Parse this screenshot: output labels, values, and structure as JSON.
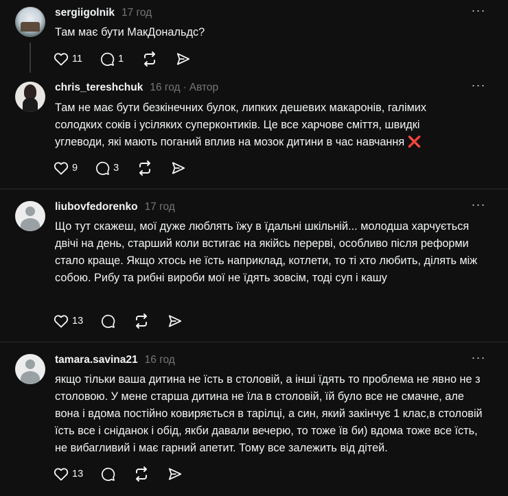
{
  "posts": [
    {
      "username": "sergiigolnik",
      "time": "17 год",
      "text": "Там має бути МакДональдс?",
      "likes": "11",
      "replies": "1",
      "avatar": "photo"
    },
    {
      "username": "chris_tereshchuk",
      "time": "16 год",
      "separator": "·",
      "author_badge": "Автор",
      "text": "Там не має бути безкінечних булок, липких дешевих макаронів, галімих солодких соків і усіляких суперконтиків. Це все харчове сміття, швидкі углеводи, які мають поганий вплив на мозок дитини в час навчання",
      "emoji": "❌",
      "likes": "9",
      "replies": "3",
      "avatar": "photo"
    },
    {
      "username": "liubovfedorenko",
      "time": "17 год",
      "text": "Що тут скажеш, мої дуже люблять їжу в їдальні шкільній... молодша харчується двічі на день, старший коли встигає на якійсь перерві, особливо після реформи стало краще. Якщо хтось не їсть наприклад, котлети, то ті хто любить, ділять між собою. Рибу та рибні вироби мої не їдять зовсім, тоді суп і кашу",
      "likes": "13",
      "avatar": "default"
    },
    {
      "username": "tamara.savina21",
      "time": "16 год",
      "text": "якщо тільки ваша дитина не їсть в столовій, а інші їдять то проблема не явно не з столовою. У мене старша дитина не їла в столовій, їй було все не смачне, але вона і вдома постійно ковиряється в тарілці, а син, який закінчує 1 клас,в столовій їсть все і сніданок і обід, якби давали вечерю, то тоже їв би) вдома тоже все їсть, не вибагливий і має гарний апетит. Тому все залежить від дітей.",
      "likes": "13",
      "avatar": "default"
    }
  ],
  "icons": {
    "like": "heart-icon",
    "reply": "comment-icon",
    "repost": "repost-icon",
    "share": "send-icon",
    "more": "more-icon"
  },
  "colors": {
    "background": "#101010",
    "text": "#f3f5f7",
    "muted": "#777777",
    "divider": "#2d2d2d",
    "x_mark": "#e0332c"
  }
}
